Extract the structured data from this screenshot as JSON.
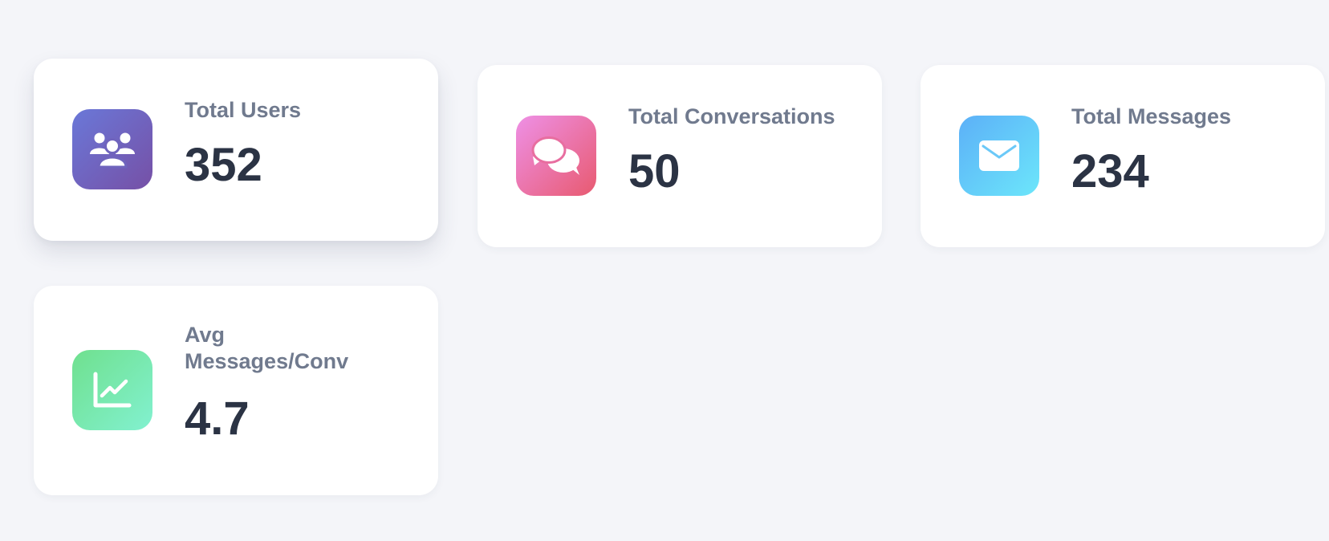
{
  "stats": [
    {
      "label": "Total Users",
      "value": "352",
      "icon": "users-icon",
      "gradient": [
        "#6a78d8",
        "#7650a6"
      ]
    },
    {
      "label": "Total Conversations",
      "value": "50",
      "icon": "chat-bubbles-icon",
      "gradient": [
        "#ee90e6",
        "#e85a70"
      ]
    },
    {
      "label": "Total Messages",
      "value": "234",
      "icon": "envelope-icon",
      "gradient": [
        "#5cb0f8",
        "#6ce6fa"
      ]
    },
    {
      "label": "Avg Messages/Conv",
      "value": "4.7",
      "icon": "line-chart-icon",
      "gradient": [
        "#6fe08e",
        "#82f1d0"
      ]
    }
  ],
  "colors": {
    "background": "#f4f5f9",
    "card": "#ffffff",
    "label": "#707a8e",
    "value": "#2b3344"
  }
}
